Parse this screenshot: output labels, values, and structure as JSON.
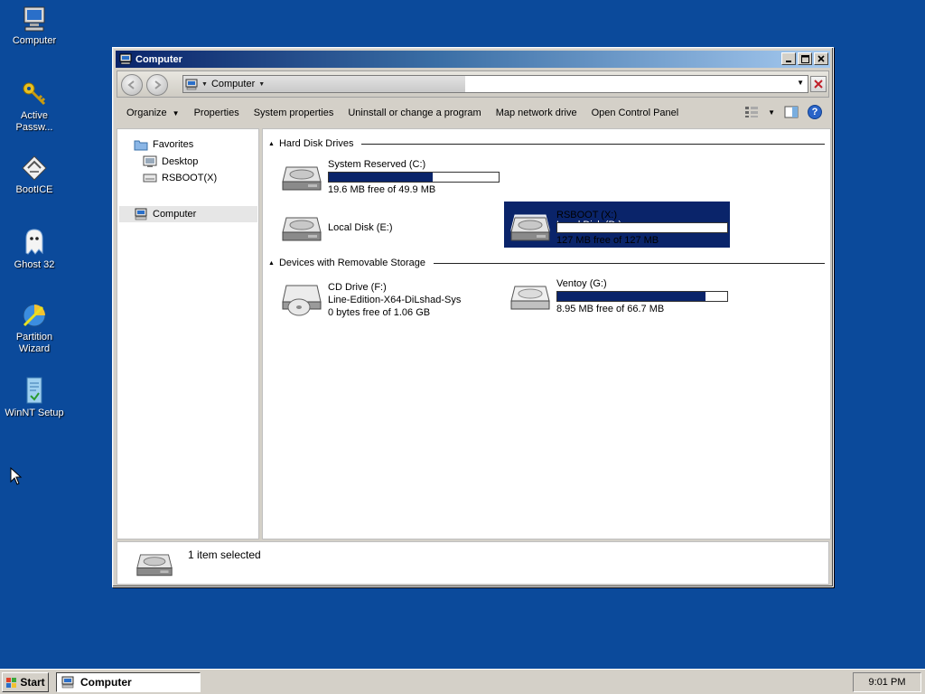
{
  "desktop": {
    "icons": [
      {
        "label": "Computer",
        "icon": "computer-icon"
      },
      {
        "label": "Active Passw...",
        "icon": "key-icon"
      },
      {
        "label": "BootICE",
        "icon": "booticE-icon"
      },
      {
        "label": "Ghost 32",
        "icon": "ghost-icon"
      },
      {
        "label": "Partition Wizard",
        "icon": "partition-wizard-icon"
      },
      {
        "label": "WinNT Setup",
        "icon": "winnt-setup-icon"
      }
    ]
  },
  "window": {
    "title": "Computer",
    "address": {
      "crumb": "Computer"
    },
    "toolbar": {
      "organize": "Organize",
      "properties": "Properties",
      "system_properties": "System properties",
      "uninstall": "Uninstall or change a program",
      "map_drive": "Map network drive",
      "control_panel": "Open Control Panel",
      "help": "?"
    },
    "nav": {
      "favorites": "Favorites",
      "desktop": "Desktop",
      "rsboot": "RSBOOT(X)",
      "computer": "Computer"
    },
    "groups": {
      "hdd": "Hard Disk Drives",
      "removable": "Devices with Removable Storage"
    },
    "drives": [
      {
        "name": "System Reserved (C:)",
        "free": "19.6 MB free of 49.9 MB",
        "used_fraction": 0.61
      },
      {
        "name": "Local Disk (D:)",
        "selected": true
      },
      {
        "name": "Local Disk (E:)"
      },
      {
        "name": "RSBOOT (X:)",
        "free": "127 MB free of 127 MB",
        "used_fraction": 0.0
      },
      {
        "name": "CD Drive (F:)",
        "label": "Line-Edition-X64-DiLshad-Sys",
        "free": "0 bytes free of 1.06 GB"
      },
      {
        "name": "Ventoy (G:)",
        "free": "8.95 MB free of 66.7 MB",
        "used_fraction": 0.87
      }
    ],
    "details": {
      "status": "1 item selected"
    }
  },
  "taskbar": {
    "start": "Start",
    "task": "Computer",
    "clock": "9:01 PM"
  },
  "colors": {
    "desktop": "#0b4a9b",
    "selection": "#0a246a",
    "title_start": "#0a246a"
  }
}
